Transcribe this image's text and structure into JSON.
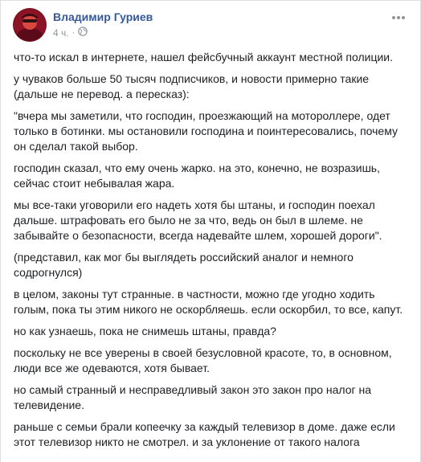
{
  "post": {
    "author_name": "Владимир Гуриев",
    "timestamp": "4 ч.",
    "separator": "·",
    "icons": {
      "audience": "globe-icon",
      "more": "more-options-icon"
    },
    "paragraphs": [
      "что-то искал в интернете, нашел фейсбучный аккаунт местной полиции.",
      "у чуваков больше 50 тысяч подписчиков, и новости примерно такие (дальше не перевод. а пересказ):",
      "\"вчера мы заметили, что господин, проезжающий на мотороллере, одет только в ботинки. мы остановили господина и поинтересовались, почему он сделал такой выбор.",
      "господин сказал, что ему очень жарко. на это, конечно, не возразишь, сейчас стоит небывалая жара.",
      "мы все-таки уговорили его надеть хотя бы штаны, и господин поехал дальше. штрафовать его было не за что, ведь он был в шлеме. не забывайте о безопасности, всегда надевайте шлем, хорошей дороги\".",
      "(представил, как мог бы выглядеть российский аналог и немного содрогнулся)",
      "в целом, законы тут странные. в частности, можно где угодно ходить голым, пока ты этим никого не оскорбляешь. если оскорбил, то все, капут.",
      "но как узнаешь, пока не снимешь штаны, правда?",
      "поскольку не все уверены в своей безусловной красоте, то, в основном, люди все же одеваются, хотя бывает.",
      "но самый странный и несправедливый закон это закон про налог на телевидение.",
      "раньше с семьи брали копеечку за каждый телевизор в доме. даже если этот телевизор никто не смотрел. и за уклонение от такого налога"
    ]
  }
}
